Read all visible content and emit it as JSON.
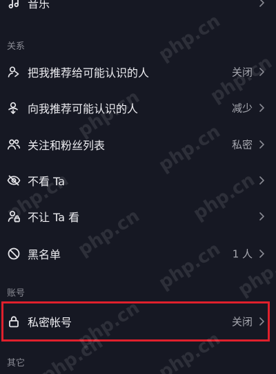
{
  "top_item": {
    "label": "音乐"
  },
  "sections": {
    "relations_title": "关系",
    "account_title": "账号",
    "other_title": "其它"
  },
  "relations": [
    {
      "label": "把我推荐给可能认识的人",
      "value": "关闭",
      "icon": "person-share-icon"
    },
    {
      "label": "向我推荐可能认识的人",
      "value": "减少",
      "icon": "person-recommend-icon"
    },
    {
      "label": "关注和粉丝列表",
      "value": "私密",
      "icon": "people-list-icon"
    },
    {
      "label": "不看 Ta",
      "value": "",
      "icon": "eye-off-icon"
    },
    {
      "label": "不让 Ta 看",
      "value": "",
      "icon": "person-lock-icon"
    },
    {
      "label": "黑名单",
      "value": "1 人",
      "icon": "block-icon"
    }
  ],
  "account": [
    {
      "label": "私密帐号",
      "value": "关闭",
      "icon": "lock-icon"
    }
  ],
  "watermark": "php.cn",
  "colors": {
    "background": "#161823",
    "highlight": "#e0202c",
    "text": "#ececf0",
    "secondary_text": "#a7a8b0"
  }
}
